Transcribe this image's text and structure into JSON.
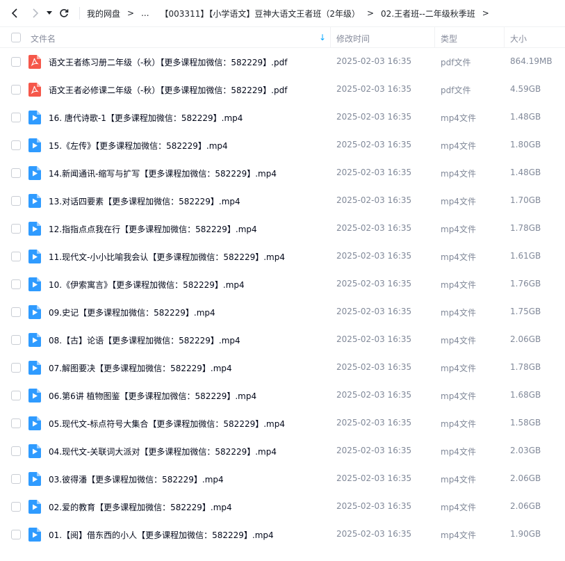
{
  "breadcrumb": {
    "items": [
      "我的网盘",
      "...",
      "【003311】【小学语文】豆神大语文王者班（2年级）",
      "02.王者班--二年级秋季班"
    ]
  },
  "header": {
    "name": "文件名",
    "time": "修改时间",
    "type": "类型",
    "size": "大小"
  },
  "colors": {
    "accent": "#06a7ff",
    "pdf": "#f5574a",
    "video": "#2f9bff"
  },
  "files": [
    {
      "name": "语文王者练习册二年级（-秋）【更多课程加微信：582229】.pdf",
      "time": "2025-02-03 16:35",
      "type": "pdf文件",
      "size": "864.19MB",
      "icon": "pdf-icon"
    },
    {
      "name": "语文王者必修课二年级（-秋）【更多课程加微信：582229】.pdf",
      "time": "2025-02-03 16:35",
      "type": "pdf文件",
      "size": "4.59GB",
      "icon": "pdf-icon"
    },
    {
      "name": "16. 唐代诗歌-1【更多课程加微信：582229】.mp4",
      "time": "2025-02-03 16:35",
      "type": "mp4文件",
      "size": "1.48GB",
      "icon": "video-icon"
    },
    {
      "name": "15.《左传》【更多课程加微信：582229】.mp4",
      "time": "2025-02-03 16:35",
      "type": "mp4文件",
      "size": "1.80GB",
      "icon": "video-icon"
    },
    {
      "name": "14.新闻通讯-缩写与扩写【更多课程加微信：582229】.mp4",
      "time": "2025-02-03 16:35",
      "type": "mp4文件",
      "size": "1.48GB",
      "icon": "video-icon"
    },
    {
      "name": "13.对话四要素【更多课程加微信：582229】.mp4",
      "time": "2025-02-03 16:35",
      "type": "mp4文件",
      "size": "1.70GB",
      "icon": "video-icon"
    },
    {
      "name": "12.指指点点我在行【更多课程加微信：582229】.mp4",
      "time": "2025-02-03 16:35",
      "type": "mp4文件",
      "size": "1.78GB",
      "icon": "video-icon"
    },
    {
      "name": "11.现代文-小小比喻我会认【更多课程加微信：582229】.mp4",
      "time": "2025-02-03 16:35",
      "type": "mp4文件",
      "size": "1.61GB",
      "icon": "video-icon"
    },
    {
      "name": "10.《伊索寓言》【更多课程加微信：582229】.mp4",
      "time": "2025-02-03 16:35",
      "type": "mp4文件",
      "size": "1.76GB",
      "icon": "video-icon"
    },
    {
      "name": "09.史记【更多课程加微信：582229】.mp4",
      "time": "2025-02-03 16:35",
      "type": "mp4文件",
      "size": "1.75GB",
      "icon": "video-icon"
    },
    {
      "name": "08.【古】论语【更多课程加微信：582229】.mp4",
      "time": "2025-02-03 16:35",
      "type": "mp4文件",
      "size": "2.06GB",
      "icon": "video-icon"
    },
    {
      "name": "07.解图要决【更多课程加微信：582229】.mp4",
      "time": "2025-02-03 16:35",
      "type": "mp4文件",
      "size": "1.78GB",
      "icon": "video-icon"
    },
    {
      "name": "06.第6讲 植物图鉴【更多课程加微信：582229】.mp4",
      "time": "2025-02-03 16:35",
      "type": "mp4文件",
      "size": "1.68GB",
      "icon": "video-icon"
    },
    {
      "name": "05.现代文-标点符号大集合【更多课程加微信：582229】.mp4",
      "time": "2025-02-03 16:35",
      "type": "mp4文件",
      "size": "1.58GB",
      "icon": "video-icon"
    },
    {
      "name": "04.现代文-关联词大派对【更多课程加微信：582229】.mp4",
      "time": "2025-02-03 16:35",
      "type": "mp4文件",
      "size": "2.03GB",
      "icon": "video-icon"
    },
    {
      "name": "03.彼得潘【更多课程加微信：582229】.mp4",
      "time": "2025-02-03 16:35",
      "type": "mp4文件",
      "size": "2.06GB",
      "icon": "video-icon"
    },
    {
      "name": "02.爱的教育【更多课程加微信：582229】.mp4",
      "time": "2025-02-03 16:35",
      "type": "mp4文件",
      "size": "2.06GB",
      "icon": "video-icon"
    },
    {
      "name": "01.【阅】借东西的小人【更多课程加微信：582229】.mp4",
      "time": "2025-02-03 16:35",
      "type": "mp4文件",
      "size": "1.90GB",
      "icon": "video-icon"
    }
  ]
}
